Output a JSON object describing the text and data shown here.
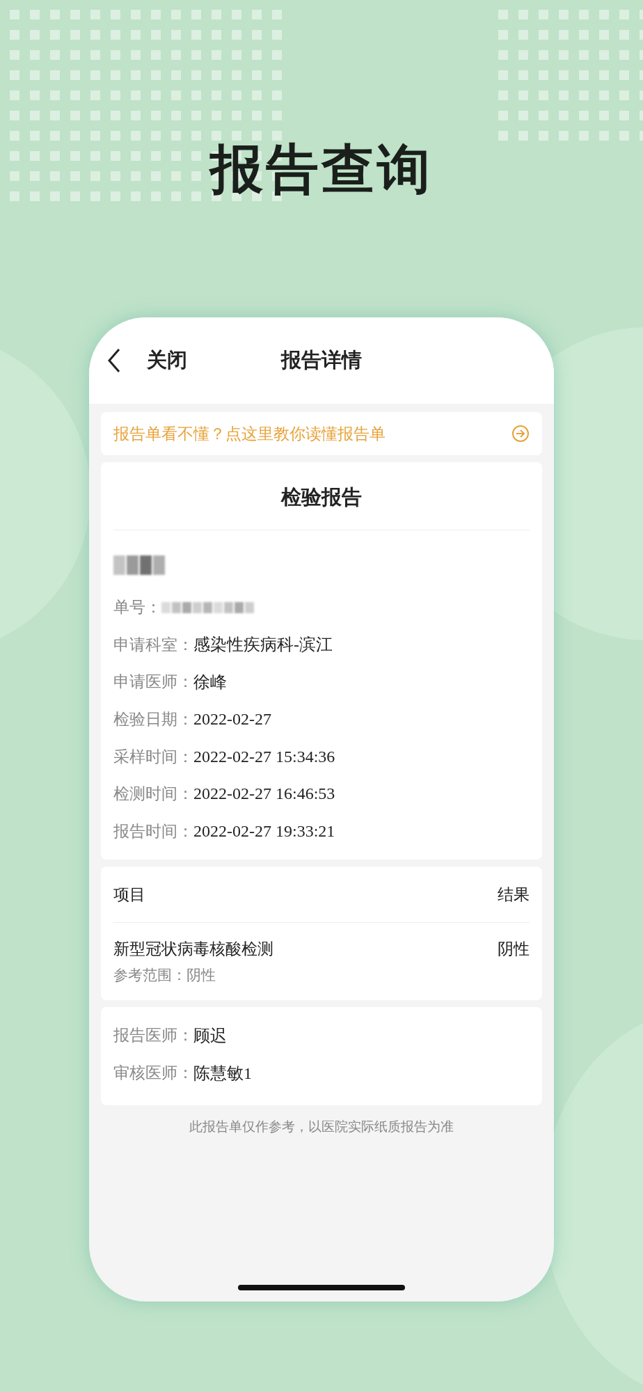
{
  "title": "报告查询",
  "nav": {
    "close": "关闭",
    "title": "报告详情"
  },
  "banner": {
    "text": "报告单看不懂？点这里教你读懂报告单"
  },
  "report": {
    "title": "检验报告",
    "fields": [
      {
        "kind": "redacted"
      },
      {
        "kind": "redacted",
        "label": "单号："
      },
      {
        "kind": "text",
        "label": "申请科室：",
        "value": "感染性疾病科-滨江"
      },
      {
        "kind": "text",
        "label": "申请医师：",
        "value": "徐峰"
      },
      {
        "kind": "text",
        "label": "检验日期：",
        "value": "2022-02-27"
      },
      {
        "kind": "text",
        "label": "采样时间：",
        "value": "2022-02-27 15:34:36"
      },
      {
        "kind": "text",
        "label": "检测时间：",
        "value": "2022-02-27 16:46:53"
      },
      {
        "kind": "text",
        "label": "报告时间：",
        "value": "2022-02-27 19:33:21"
      }
    ]
  },
  "results": {
    "columns": [
      "项目",
      "结果"
    ],
    "rows": [
      {
        "name": "新型冠状病毒核酸检测",
        "result": "阴性",
        "reference": "参考范围：阴性"
      }
    ]
  },
  "doctors": [
    {
      "label": "报告医师：",
      "value": "顾迟"
    },
    {
      "label": "审核医师：",
      "value": "陈慧敏1"
    }
  ],
  "footer": "此报告单仅作参考，以医院实际纸质报告为准"
}
